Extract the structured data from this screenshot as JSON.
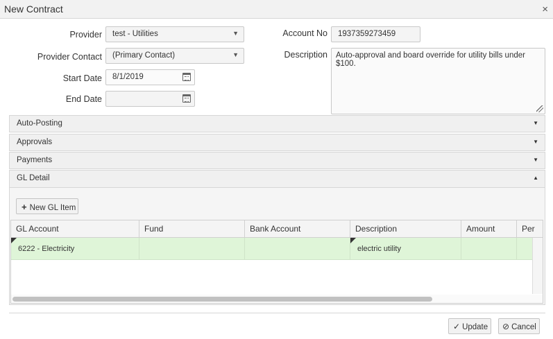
{
  "dialog": {
    "title": "New Contract",
    "close_symbol": "×"
  },
  "form": {
    "provider": {
      "label": "Provider",
      "value": "test - Utilities"
    },
    "provider_contact": {
      "label": "Provider Contact",
      "value": "(Primary Contact)"
    },
    "start_date": {
      "label": "Start Date",
      "value": "8/1/2019"
    },
    "end_date": {
      "label": "End Date",
      "value": ""
    },
    "account_no": {
      "label": "Account No",
      "value": "1937359273459"
    },
    "description": {
      "label": "Description",
      "value": "Auto-approval and board override for utility bills under $100."
    }
  },
  "sections": [
    {
      "title": "Auto-Posting",
      "state": "collapsed",
      "chevron": "▼"
    },
    {
      "title": "Approvals",
      "state": "collapsed",
      "chevron": "▼"
    },
    {
      "title": "Payments",
      "state": "collapsed",
      "chevron": "▼"
    },
    {
      "title": "GL Detail",
      "state": "expanded",
      "chevron": "▲"
    }
  ],
  "gl_detail": {
    "new_item_label": "New GL Item",
    "columns": [
      "GL Account",
      "Fund",
      "Bank Account",
      "Description",
      "Amount",
      "Per"
    ],
    "rows": [
      {
        "gl_account": "6222 - Electricity",
        "fund": "",
        "bank_account": "",
        "description": "electric utility",
        "amount": "",
        "per": ""
      }
    ]
  },
  "footer": {
    "update_label": "Update",
    "cancel_label": "Cancel"
  },
  "colors": {
    "selected_row": "#dff5d8",
    "panel_bg": "#f0f0f0"
  }
}
